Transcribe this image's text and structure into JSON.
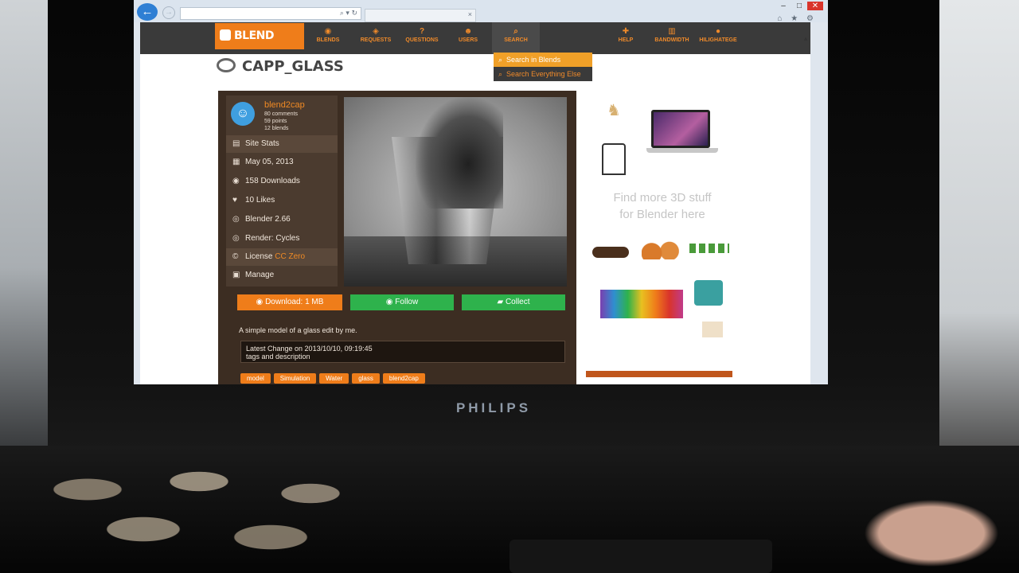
{
  "monitor": {
    "brand": "PHILIPS"
  },
  "browser": {
    "back_icon": "arrow-left-icon",
    "forward_icon": "arrow-right-icon",
    "address_icons": "⌕ ▾ ↻",
    "tab_close": "×",
    "window_controls": [
      "–",
      "□",
      "✕"
    ],
    "toolbar_icons": "⌂ ★ ⚙"
  },
  "site": {
    "logo": "BLEND SWAP",
    "nav": [
      {
        "label": "BLENDS",
        "icon": "blender-icon"
      },
      {
        "label": "REQUESTS",
        "icon": "tag-icon"
      },
      {
        "label": "QUESTIONS",
        "icon": "question-icon"
      },
      {
        "label": "USERS",
        "icon": "users-icon"
      },
      {
        "label": "SEARCH",
        "icon": "search-icon"
      }
    ],
    "nav_right": [
      {
        "label": "HELP",
        "icon": "lifebuoy-icon"
      },
      {
        "label": "BANDWIDTH",
        "icon": "bar-chart-icon"
      },
      {
        "label": "HILIGHATEGE",
        "icon": "user-icon"
      }
    ],
    "search_dropdown": [
      "Search in Blends",
      "Search Everything Else"
    ]
  },
  "page": {
    "title": "CAPP_GLASS",
    "user": {
      "name": "blend2cap",
      "comments": "80 comments",
      "points": "59 points",
      "blends": "12 blends"
    },
    "sidebar": [
      {
        "label": "Site Stats",
        "icon": "stats-icon"
      },
      {
        "label": "May 05, 2013",
        "icon": "calendar-icon"
      },
      {
        "label": "158 Downloads",
        "icon": "eye-icon"
      },
      {
        "label": "10 Likes",
        "icon": "heart-icon"
      },
      {
        "label": "Blender 2.66",
        "icon": "blender-icon"
      },
      {
        "label": "Render: Cycles",
        "icon": "blender-icon"
      },
      {
        "label": "License",
        "value": "CC Zero",
        "icon": "cc-icon"
      },
      {
        "label": "Manage",
        "icon": "grid-icon"
      }
    ],
    "buttons": {
      "download": "Download: 1 MB",
      "follow": "Follow",
      "collect": "Collect"
    },
    "description": "A simple model of a glass edit by me.",
    "latest_change": "Latest Change on 2013/10/10, 09:19:45",
    "change_note": "tags and description",
    "tags": [
      "model",
      "Simulation",
      "Water",
      "glass",
      "blend2cap"
    ]
  },
  "ad": {
    "line1": "Find more 3D stuff",
    "line2": "for Blender here"
  }
}
